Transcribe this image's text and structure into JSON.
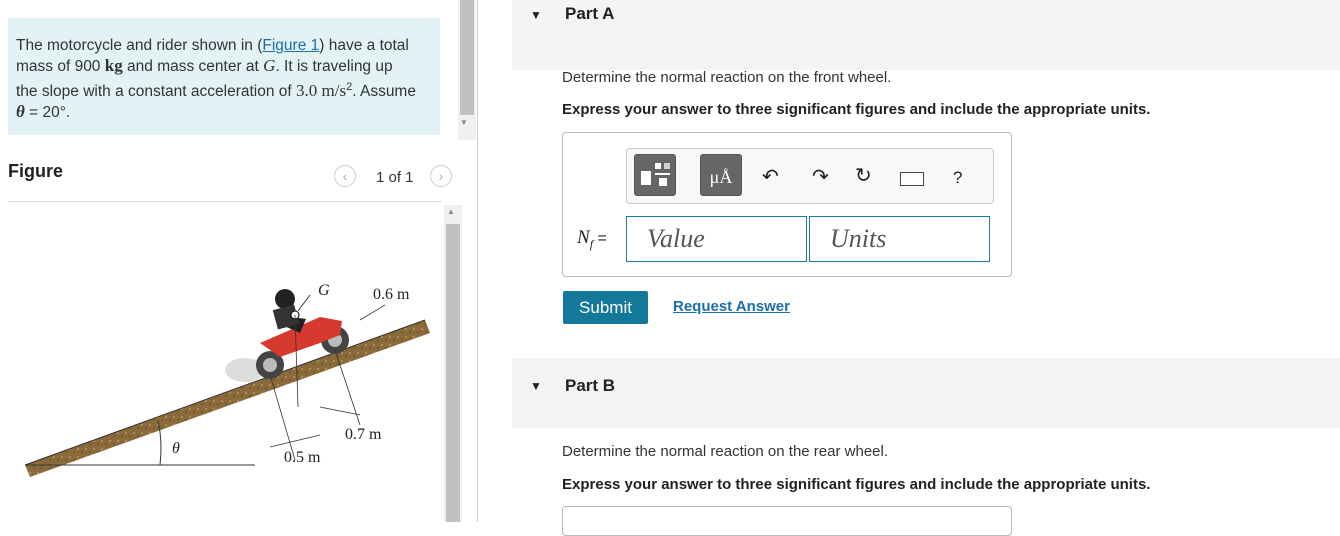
{
  "problem": {
    "text_1": "The motorcycle and rider shown in (",
    "link": "Figure 1",
    "text_2": ") have a total mass of 900 ",
    "unit_kg": "kg",
    "text_3": " and mass center at ",
    "var_g": "G",
    "text_4": ". It is traveling up the slope with a constant acceleration of ",
    "accel": "3.0 m/s",
    "accel_exp": "2",
    "text_5": ". Assume ",
    "theta": "θ",
    "text_6": " = 20°."
  },
  "figure": {
    "title": "Figure",
    "pager_label": "1 of 1",
    "prev_icon": "‹",
    "next_icon": "›",
    "labels": {
      "g": "G",
      "d1": "0.6 m",
      "d2": "0.7 m",
      "d3": "0.5 m",
      "theta": "θ"
    }
  },
  "part_a": {
    "title": "Part A",
    "prompt": "Determine the normal reaction on the front wheel.",
    "instruction": "Express your answer to three significant figures and include the appropriate units.",
    "var_label": "N",
    "var_sub": "f",
    "equals": " =",
    "value_placeholder": "Value",
    "units_placeholder": "Units",
    "submit_label": "Submit",
    "request_label": "Request Answer",
    "toolbar": {
      "units_btn_label": "μÅ",
      "help_label": "?"
    }
  },
  "part_b": {
    "title": "Part B",
    "prompt": "Determine the normal reaction on the rear wheel.",
    "instruction": "Express your answer to three significant figures and include the appropriate units."
  },
  "colors": {
    "accent": "#13789a",
    "problem_bg": "#e3f3f5",
    "link": "#1a6fa8"
  }
}
